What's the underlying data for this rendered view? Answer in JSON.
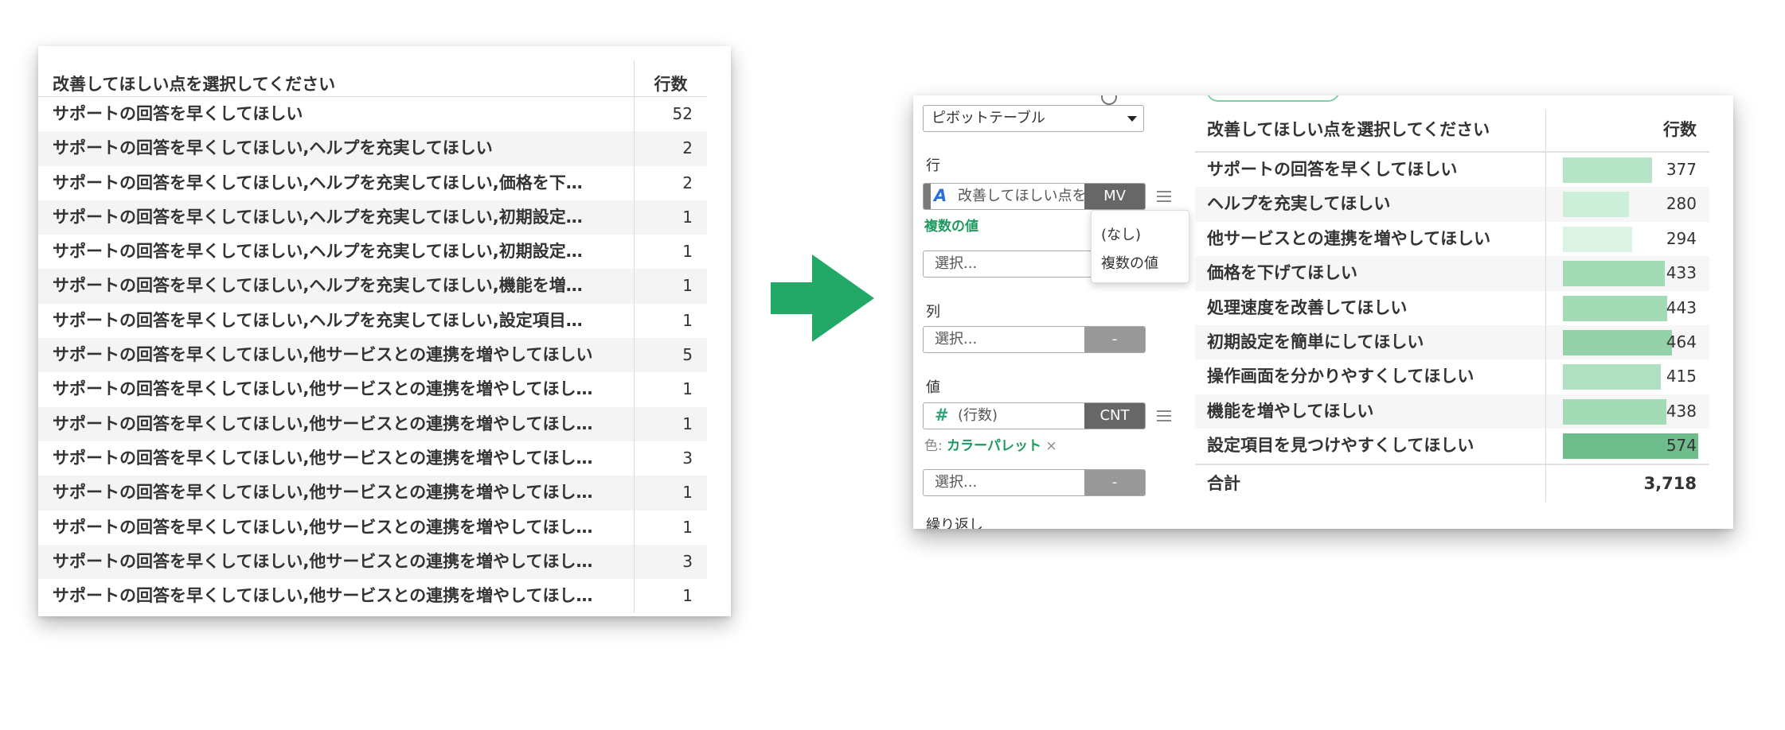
{
  "left_table": {
    "header": {
      "col1": "改善してほしい点を選択してください",
      "col2": "行数"
    },
    "rows": [
      {
        "label": "サポートの回答を早くしてほしい",
        "count": "52"
      },
      {
        "label": "サポートの回答を早くしてほしい,ヘルプを充実してほしい",
        "count": "2"
      },
      {
        "label": "サポートの回答を早くしてほしい,ヘルプを充実してほしい,価格を下…",
        "count": "2"
      },
      {
        "label": "サポートの回答を早くしてほしい,ヘルプを充実してほしい,初期設定…",
        "count": "1"
      },
      {
        "label": "サポートの回答を早くしてほしい,ヘルプを充実してほしい,初期設定…",
        "count": "1"
      },
      {
        "label": "サポートの回答を早くしてほしい,ヘルプを充実してほしい,機能を増…",
        "count": "1"
      },
      {
        "label": "サポートの回答を早くしてほしい,ヘルプを充実してほしい,設定項目…",
        "count": "1"
      },
      {
        "label": "サポートの回答を早くしてほしい,他サービスとの連携を増やしてほしい",
        "count": "5"
      },
      {
        "label": "サポートの回答を早くしてほしい,他サービスとの連携を増やしてほし…",
        "count": "1"
      },
      {
        "label": "サポートの回答を早くしてほしい,他サービスとの連携を増やしてほし…",
        "count": "1"
      },
      {
        "label": "サポートの回答を早くしてほしい,他サービスとの連携を増やしてほし…",
        "count": "3"
      },
      {
        "label": "サポートの回答を早くしてほしい,他サービスとの連携を増やしてほし…",
        "count": "1"
      },
      {
        "label": "サポートの回答を早くしてほしい,他サービスとの連携を増やしてほし…",
        "count": "1"
      },
      {
        "label": "サポートの回答を早くしてほしい,他サービスとの連携を増やしてほし…",
        "count": "3"
      },
      {
        "label": "サポートの回答を早くしてほしい,他サービスとの連携を増やしてほし…",
        "count": "1"
      }
    ]
  },
  "arrow": {
    "color": "#22a867"
  },
  "config": {
    "chart_type": "ピボットテーブル",
    "rows_label": "行",
    "row_field": {
      "name": "改善してほしい点を選択してください",
      "button": "MV"
    },
    "multi_values_link": "複数の値",
    "select_placeholder": "選択...",
    "cols_label": "列",
    "dash": "-",
    "values_label": "値",
    "value_field": {
      "name": "(行数)",
      "button": "CNT"
    },
    "color_prefix": "色: ",
    "color_palette": "カラーパレット",
    "color_clear": "×",
    "repeat_label": "繰り返し",
    "dropdown": {
      "none_option": "(なし)",
      "multi_option": "複数の値"
    }
  },
  "pivot": {
    "header": {
      "col1": "改善してほしい点を選択してください",
      "col2": "行数"
    },
    "rows": [
      {
        "label": "サポートの回答を早くしてほしい",
        "value": 377,
        "display": "377",
        "bar_color": "#b5e3c6"
      },
      {
        "label": "ヘルプを充実してほしい",
        "value": 280,
        "display": "280",
        "bar_color": "#cdeed8"
      },
      {
        "label": "他サービスとの連携を増やしてほしい",
        "value": 294,
        "display": "294",
        "bar_color": "#dcf3e3"
      },
      {
        "label": "価格を下げてほしい",
        "value": 433,
        "display": "433",
        "bar_color": "#a4dbb7"
      },
      {
        "label": "処理速度を改善してほしい",
        "value": 443,
        "display": "443",
        "bar_color": "#a4dbb7"
      },
      {
        "label": "初期設定を簡単にしてほしい",
        "value": 464,
        "display": "464",
        "bar_color": "#95d2aa"
      },
      {
        "label": "操作画面を分かりやすくしてほしい",
        "value": 415,
        "display": "415",
        "bar_color": "#b0dfc1"
      },
      {
        "label": "機能を増やしてほしい",
        "value": 438,
        "display": "438",
        "bar_color": "#a4dbb7"
      },
      {
        "label": "設定項目を見つけやすくしてほしい",
        "value": 574,
        "display": "574",
        "bar_color": "#6ebd8c"
      }
    ],
    "total_label": "合計",
    "total_value": "3,718"
  }
}
